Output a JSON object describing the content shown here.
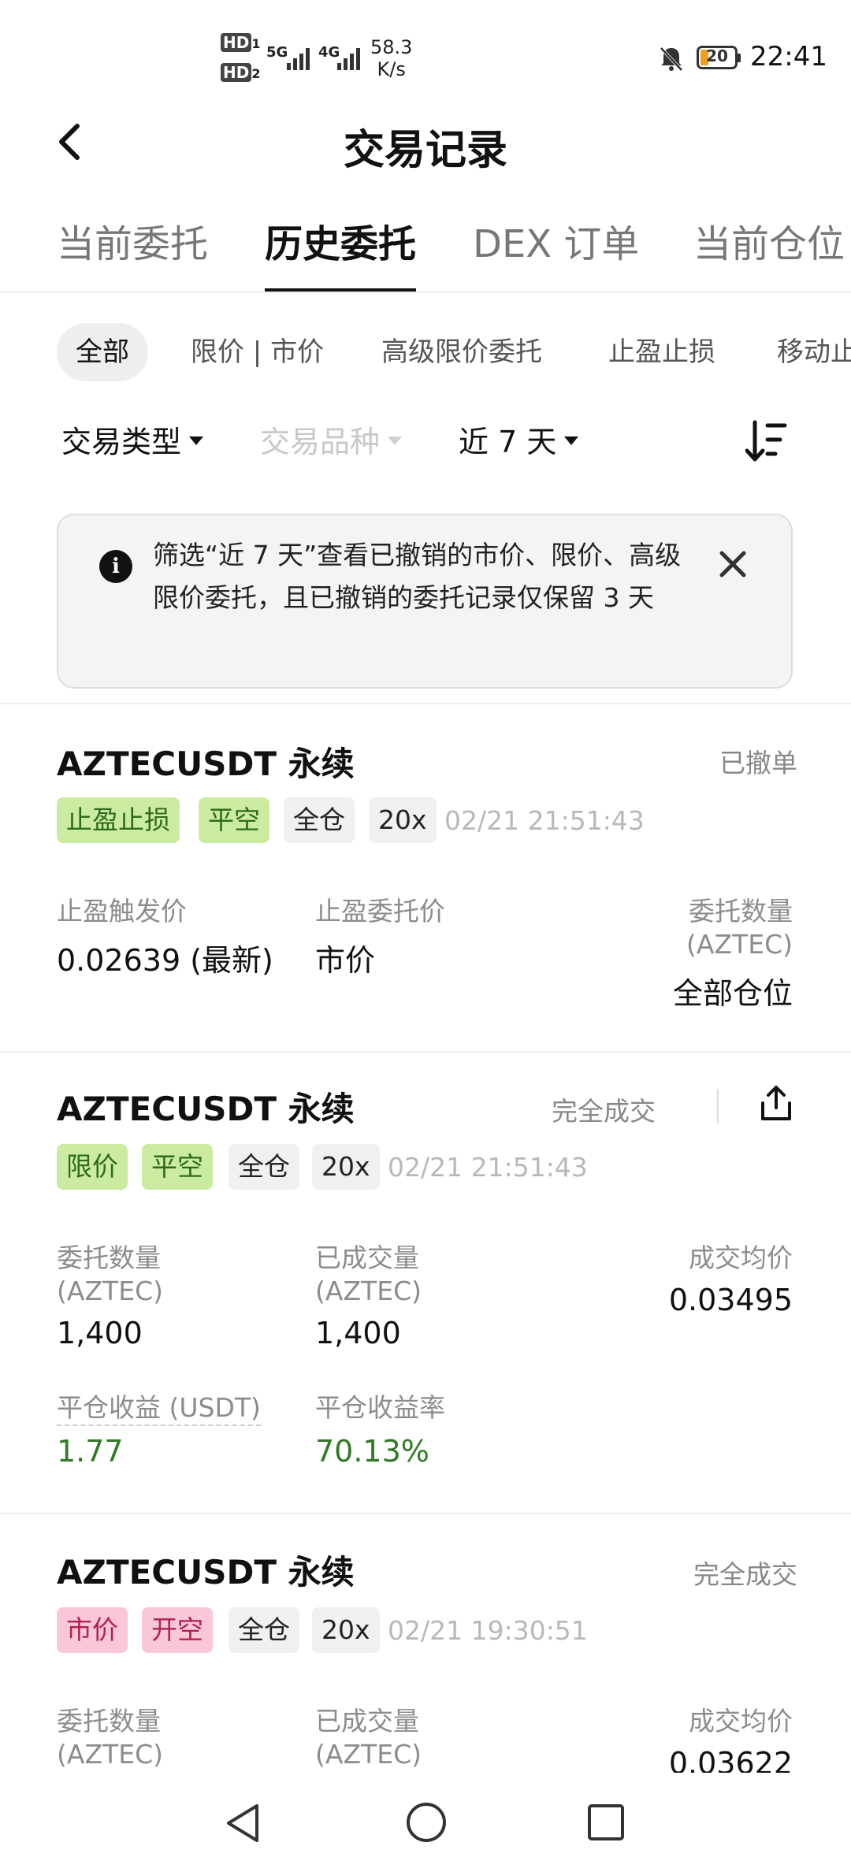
{
  "status_bar": {
    "hd1": "HD",
    "hd1_sub": "1",
    "hd2": "HD",
    "hd2_sub": "2",
    "net1": "5G",
    "net2": "4G",
    "speed_value": "58.3",
    "speed_unit": "K/s",
    "battery": "20",
    "time": "22:41"
  },
  "header": {
    "title": "交易记录"
  },
  "tabs": [
    "当前委托",
    "历史委托",
    "DEX 订单",
    "当前仓位"
  ],
  "active_tab_index": 1,
  "chips": [
    "全部",
    "限价 | 市价",
    "高级限价委托",
    "止盈止损",
    "移动止"
  ],
  "filters": {
    "trade_type": "交易类型",
    "instrument": "交易品种",
    "period": "近 7 天"
  },
  "banner": {
    "text": "筛选“近 7 天”查看已撤销的市价、限价、高级限价委托，且已撤销的委托记录仅保留 3 天",
    "icon": "info-icon"
  },
  "orders": [
    {
      "symbol": "AZTECUSDT 永续",
      "status": "已撤单",
      "tags": [
        {
          "text": "止盈止损",
          "color": "green"
        },
        {
          "text": "平空",
          "color": "green"
        },
        {
          "text": "全仓",
          "color": "gray"
        },
        {
          "text": "20x",
          "color": "gray"
        }
      ],
      "time": "02/21 21:51:43",
      "fields": [
        {
          "label": "止盈触发价",
          "value": "0.02639 (最新)"
        },
        {
          "label": "止盈委托价",
          "value": "市价"
        },
        {
          "label": "委托数量",
          "label2": "(AZTEC)",
          "value": "全部仓位"
        }
      ]
    },
    {
      "symbol": "AZTECUSDT 永续",
      "status": "完全成交",
      "tags": [
        {
          "text": "限价",
          "color": "green"
        },
        {
          "text": "平空",
          "color": "green"
        },
        {
          "text": "全仓",
          "color": "gray"
        },
        {
          "text": "20x",
          "color": "gray"
        }
      ],
      "time": "02/21 21:51:43",
      "fields": [
        {
          "label": "委托数量",
          "label2": "(AZTEC)",
          "value": "1,400"
        },
        {
          "label": "已成交量",
          "label2": "(AZTEC)",
          "value": "1,400"
        },
        {
          "label": "成交均价",
          "value": "0.03495"
        }
      ],
      "pnl": [
        {
          "label": "平仓收益 (USDT)",
          "value": "1.77"
        },
        {
          "label": "平仓收益率",
          "value": "70.13%"
        }
      ]
    },
    {
      "symbol": "AZTECUSDT 永续",
      "status": "完全成交",
      "tags": [
        {
          "text": "市价",
          "color": "pink"
        },
        {
          "text": "开空",
          "color": "pink"
        },
        {
          "text": "全仓",
          "color": "gray"
        },
        {
          "text": "20x",
          "color": "gray"
        }
      ],
      "time": "02/21 19:30:51",
      "fields": [
        {
          "label": "委托数量",
          "label2": "(AZTEC)"
        },
        {
          "label": "已成交量",
          "label2": "(AZTEC)"
        },
        {
          "label": "成交均价",
          "value": "0.03622"
        }
      ]
    }
  ],
  "colors": {
    "green_tag_bg": "#cbeca0",
    "pink_tag_bg": "#f9c7d6",
    "profit_green": "#2f7a23"
  }
}
